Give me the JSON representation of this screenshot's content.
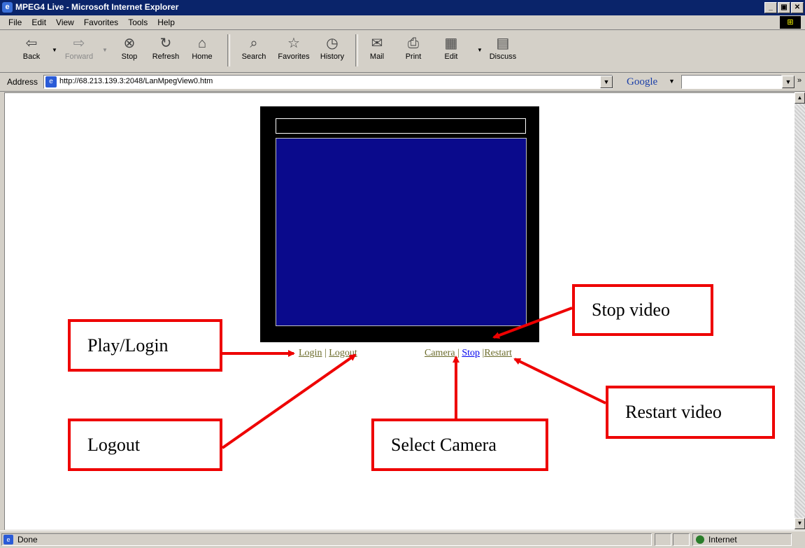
{
  "window": {
    "title": "MPEG4 Live - Microsoft Internet Explorer",
    "app_icon": "ie-icon",
    "controls": [
      "_",
      "▣",
      "✕"
    ]
  },
  "menu": [
    "File",
    "Edit",
    "View",
    "Favorites",
    "Tools",
    "Help"
  ],
  "toolbar": {
    "back": "Back",
    "forward": "Forward",
    "stop": "Stop",
    "refresh": "Refresh",
    "home": "Home",
    "search": "Search",
    "favorites": "Favorites",
    "history": "History",
    "mail": "Mail",
    "print": "Print",
    "edit": "Edit",
    "discuss": "Discuss"
  },
  "address": {
    "label": "Address",
    "url": "http://68.213.139.3:2048/LanMpegView0.htm"
  },
  "google": {
    "label": "Google",
    "value": ""
  },
  "player": {
    "title_text": ""
  },
  "links": {
    "login": "Login",
    "logout": "Logout",
    "camera": "Camera",
    "stop": "Stop",
    "restart": "Restart",
    "sep": "|"
  },
  "callouts": {
    "play_login": "Play/Login",
    "logout": "Logout",
    "stop_video": "Stop video",
    "restart_video": "Restart video",
    "select_camera": "Select Camera"
  },
  "colors": {
    "callout_border": "#e00000",
    "video_screen": "#0a0a8c",
    "link_visited": "#6b6b2a",
    "link_active": "#0000ee"
  },
  "status": {
    "text": "Done",
    "zone": "Internet"
  }
}
